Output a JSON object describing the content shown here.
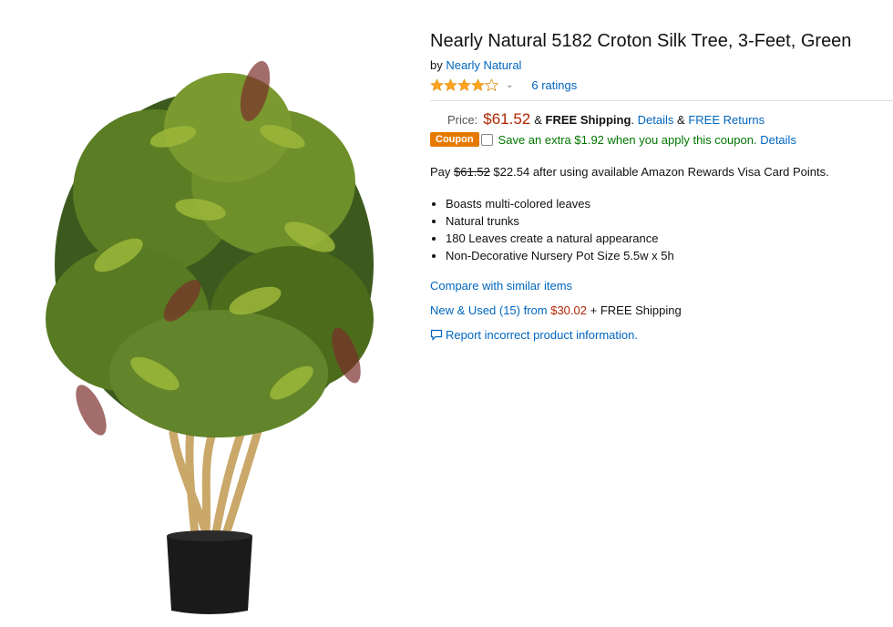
{
  "product": {
    "image_alt": "Croton silk tree in black pot",
    "title": "Nearly Natural 5182 Croton Silk Tree, 3-Feet, Green",
    "by_prefix": "by",
    "brand": "Nearly Natural",
    "rating_stars": 4,
    "ratings_count": "6 ratings"
  },
  "price": {
    "label": "Price:",
    "value": "$61.52",
    "amp": "&",
    "shipping": "FREE Shipping",
    "shipping_suffix": ".",
    "details": "Details",
    "amp2": "&",
    "returns": "FREE Returns"
  },
  "coupon": {
    "badge": "Coupon",
    "text": "Save an extra $1.92 when you apply this coupon.",
    "details": "Details"
  },
  "pay": {
    "prefix": "Pay",
    "old_price": "$61.52",
    "new_price": "$22.54",
    "suffix": "after using available Amazon Rewards Visa Card Points."
  },
  "bullets": [
    "Boasts multi-colored leaves",
    "Natural trunks",
    "180 Leaves create a natural appearance",
    "Non-Decorative Nursery Pot Size 5.5w x 5h"
  ],
  "compare": "Compare with similar items",
  "used": {
    "link": "New & Used (15) from",
    "price": "$30.02",
    "shipping": "+ FREE Shipping"
  },
  "report": "Report incorrect product information.",
  "colors": {
    "link": "#0066c0",
    "price": "#b12704",
    "star": "#ffa41c",
    "coupon": "#e67a00",
    "save": "#007600"
  }
}
